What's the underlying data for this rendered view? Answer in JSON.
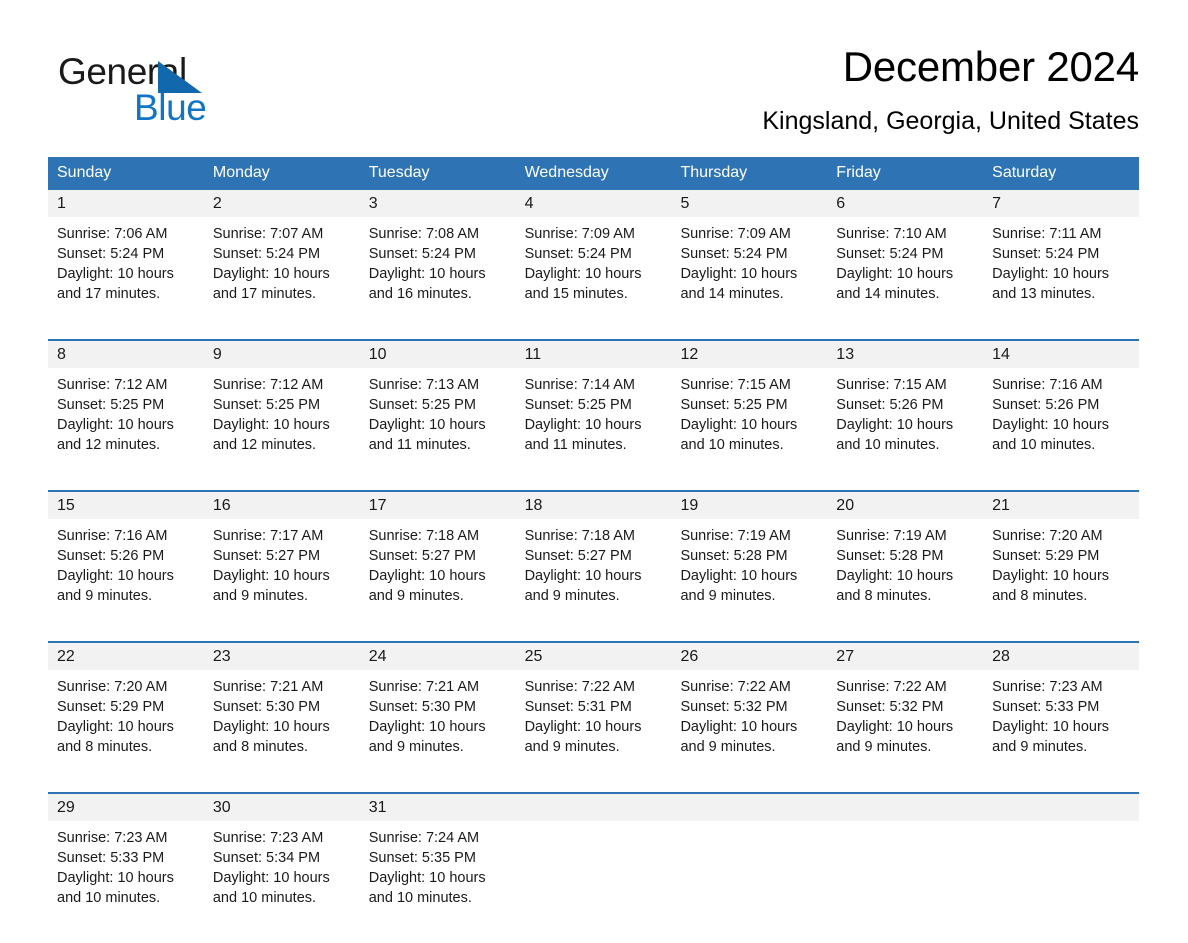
{
  "brand": {
    "name_part1": "General",
    "name_part2": "Blue",
    "triangle_color": "#1268ad",
    "blue_color": "#1175c6"
  },
  "header": {
    "title": "December 2024",
    "location": "Kingsland, Georgia, United States"
  },
  "colors": {
    "header_blue": "#2e74b5",
    "row_rule_blue": "#2e74b5",
    "daynum_band": "#f2f2f2",
    "page_background": "#ffffff"
  },
  "weekdays": [
    "Sunday",
    "Monday",
    "Tuesday",
    "Wednesday",
    "Thursday",
    "Friday",
    "Saturday"
  ],
  "weeks": [
    [
      {
        "day": "1",
        "sunrise": "Sunrise: 7:06 AM",
        "sunset": "Sunset: 5:24 PM",
        "daylight_line1": "Daylight: 10 hours",
        "daylight_line2": "and 17 minutes."
      },
      {
        "day": "2",
        "sunrise": "Sunrise: 7:07 AM",
        "sunset": "Sunset: 5:24 PM",
        "daylight_line1": "Daylight: 10 hours",
        "daylight_line2": "and 17 minutes."
      },
      {
        "day": "3",
        "sunrise": "Sunrise: 7:08 AM",
        "sunset": "Sunset: 5:24 PM",
        "daylight_line1": "Daylight: 10 hours",
        "daylight_line2": "and 16 minutes."
      },
      {
        "day": "4",
        "sunrise": "Sunrise: 7:09 AM",
        "sunset": "Sunset: 5:24 PM",
        "daylight_line1": "Daylight: 10 hours",
        "daylight_line2": "and 15 minutes."
      },
      {
        "day": "5",
        "sunrise": "Sunrise: 7:09 AM",
        "sunset": "Sunset: 5:24 PM",
        "daylight_line1": "Daylight: 10 hours",
        "daylight_line2": "and 14 minutes."
      },
      {
        "day": "6",
        "sunrise": "Sunrise: 7:10 AM",
        "sunset": "Sunset: 5:24 PM",
        "daylight_line1": "Daylight: 10 hours",
        "daylight_line2": "and 14 minutes."
      },
      {
        "day": "7",
        "sunrise": "Sunrise: 7:11 AM",
        "sunset": "Sunset: 5:24 PM",
        "daylight_line1": "Daylight: 10 hours",
        "daylight_line2": "and 13 minutes."
      }
    ],
    [
      {
        "day": "8",
        "sunrise": "Sunrise: 7:12 AM",
        "sunset": "Sunset: 5:25 PM",
        "daylight_line1": "Daylight: 10 hours",
        "daylight_line2": "and 12 minutes."
      },
      {
        "day": "9",
        "sunrise": "Sunrise: 7:12 AM",
        "sunset": "Sunset: 5:25 PM",
        "daylight_line1": "Daylight: 10 hours",
        "daylight_line2": "and 12 minutes."
      },
      {
        "day": "10",
        "sunrise": "Sunrise: 7:13 AM",
        "sunset": "Sunset: 5:25 PM",
        "daylight_line1": "Daylight: 10 hours",
        "daylight_line2": "and 11 minutes."
      },
      {
        "day": "11",
        "sunrise": "Sunrise: 7:14 AM",
        "sunset": "Sunset: 5:25 PM",
        "daylight_line1": "Daylight: 10 hours",
        "daylight_line2": "and 11 minutes."
      },
      {
        "day": "12",
        "sunrise": "Sunrise: 7:15 AM",
        "sunset": "Sunset: 5:25 PM",
        "daylight_line1": "Daylight: 10 hours",
        "daylight_line2": "and 10 minutes."
      },
      {
        "day": "13",
        "sunrise": "Sunrise: 7:15 AM",
        "sunset": "Sunset: 5:26 PM",
        "daylight_line1": "Daylight: 10 hours",
        "daylight_line2": "and 10 minutes."
      },
      {
        "day": "14",
        "sunrise": "Sunrise: 7:16 AM",
        "sunset": "Sunset: 5:26 PM",
        "daylight_line1": "Daylight: 10 hours",
        "daylight_line2": "and 10 minutes."
      }
    ],
    [
      {
        "day": "15",
        "sunrise": "Sunrise: 7:16 AM",
        "sunset": "Sunset: 5:26 PM",
        "daylight_line1": "Daylight: 10 hours",
        "daylight_line2": "and 9 minutes."
      },
      {
        "day": "16",
        "sunrise": "Sunrise: 7:17 AM",
        "sunset": "Sunset: 5:27 PM",
        "daylight_line1": "Daylight: 10 hours",
        "daylight_line2": "and 9 minutes."
      },
      {
        "day": "17",
        "sunrise": "Sunrise: 7:18 AM",
        "sunset": "Sunset: 5:27 PM",
        "daylight_line1": "Daylight: 10 hours",
        "daylight_line2": "and 9 minutes."
      },
      {
        "day": "18",
        "sunrise": "Sunrise: 7:18 AM",
        "sunset": "Sunset: 5:27 PM",
        "daylight_line1": "Daylight: 10 hours",
        "daylight_line2": "and 9 minutes."
      },
      {
        "day": "19",
        "sunrise": "Sunrise: 7:19 AM",
        "sunset": "Sunset: 5:28 PM",
        "daylight_line1": "Daylight: 10 hours",
        "daylight_line2": "and 9 minutes."
      },
      {
        "day": "20",
        "sunrise": "Sunrise: 7:19 AM",
        "sunset": "Sunset: 5:28 PM",
        "daylight_line1": "Daylight: 10 hours",
        "daylight_line2": "and 8 minutes."
      },
      {
        "day": "21",
        "sunrise": "Sunrise: 7:20 AM",
        "sunset": "Sunset: 5:29 PM",
        "daylight_line1": "Daylight: 10 hours",
        "daylight_line2": "and 8 minutes."
      }
    ],
    [
      {
        "day": "22",
        "sunrise": "Sunrise: 7:20 AM",
        "sunset": "Sunset: 5:29 PM",
        "daylight_line1": "Daylight: 10 hours",
        "daylight_line2": "and 8 minutes."
      },
      {
        "day": "23",
        "sunrise": "Sunrise: 7:21 AM",
        "sunset": "Sunset: 5:30 PM",
        "daylight_line1": "Daylight: 10 hours",
        "daylight_line2": "and 8 minutes."
      },
      {
        "day": "24",
        "sunrise": "Sunrise: 7:21 AM",
        "sunset": "Sunset: 5:30 PM",
        "daylight_line1": "Daylight: 10 hours",
        "daylight_line2": "and 9 minutes."
      },
      {
        "day": "25",
        "sunrise": "Sunrise: 7:22 AM",
        "sunset": "Sunset: 5:31 PM",
        "daylight_line1": "Daylight: 10 hours",
        "daylight_line2": "and 9 minutes."
      },
      {
        "day": "26",
        "sunrise": "Sunrise: 7:22 AM",
        "sunset": "Sunset: 5:32 PM",
        "daylight_line1": "Daylight: 10 hours",
        "daylight_line2": "and 9 minutes."
      },
      {
        "day": "27",
        "sunrise": "Sunrise: 7:22 AM",
        "sunset": "Sunset: 5:32 PM",
        "daylight_line1": "Daylight: 10 hours",
        "daylight_line2": "and 9 minutes."
      },
      {
        "day": "28",
        "sunrise": "Sunrise: 7:23 AM",
        "sunset": "Sunset: 5:33 PM",
        "daylight_line1": "Daylight: 10 hours",
        "daylight_line2": "and 9 minutes."
      }
    ],
    [
      {
        "day": "29",
        "sunrise": "Sunrise: 7:23 AM",
        "sunset": "Sunset: 5:33 PM",
        "daylight_line1": "Daylight: 10 hours",
        "daylight_line2": "and 10 minutes."
      },
      {
        "day": "30",
        "sunrise": "Sunrise: 7:23 AM",
        "sunset": "Sunset: 5:34 PM",
        "daylight_line1": "Daylight: 10 hours",
        "daylight_line2": "and 10 minutes."
      },
      {
        "day": "31",
        "sunrise": "Sunrise: 7:24 AM",
        "sunset": "Sunset: 5:35 PM",
        "daylight_line1": "Daylight: 10 hours",
        "daylight_line2": "and 10 minutes."
      },
      {
        "day": "",
        "sunrise": "",
        "sunset": "",
        "daylight_line1": "",
        "daylight_line2": ""
      },
      {
        "day": "",
        "sunrise": "",
        "sunset": "",
        "daylight_line1": "",
        "daylight_line2": ""
      },
      {
        "day": "",
        "sunrise": "",
        "sunset": "",
        "daylight_line1": "",
        "daylight_line2": ""
      },
      {
        "day": "",
        "sunrise": "",
        "sunset": "",
        "daylight_line1": "",
        "daylight_line2": ""
      }
    ]
  ]
}
